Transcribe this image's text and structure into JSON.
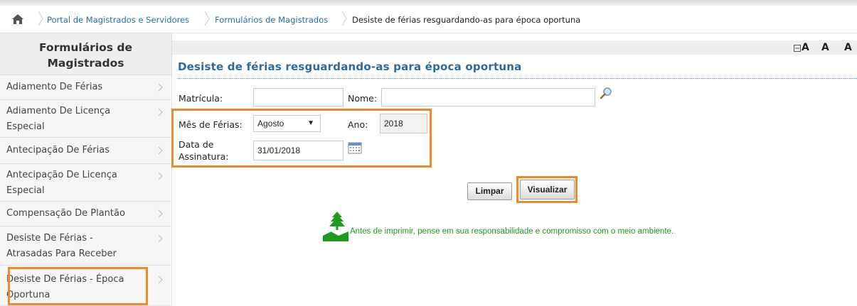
{
  "breadcrumb": {
    "items": [
      {
        "label": "Portal de Magistrados e Servidores"
      },
      {
        "label": "Formulários de Magistrados"
      },
      {
        "label": "Desiste de férias resguardando-as para época oportuna"
      }
    ]
  },
  "sidebar": {
    "title_line1": "Formulários de",
    "title_line2": "Magistrados",
    "items": [
      {
        "line1": "Adiamento De Férias",
        "line2": ""
      },
      {
        "line1": "Adiamento De Licença",
        "line2": "Especial"
      },
      {
        "line1": "Antecipação De Férias",
        "line2": ""
      },
      {
        "line1": "Antecipação De Licença",
        "line2": "Especial"
      },
      {
        "line1": "Compensação De Plantão",
        "line2": ""
      },
      {
        "line1": "Desiste De Férias -",
        "line2": "Atrasadas Para Receber"
      },
      {
        "line1": "Desiste De Férias - Época",
        "line2": "Oportuna"
      }
    ]
  },
  "toolbar": {
    "font_decrease": "A",
    "font_normal": "A",
    "font_increase": "A"
  },
  "page": {
    "title": "Desiste de férias resguardando-as para época oportuna"
  },
  "form": {
    "matricula_label": "Matrícula:",
    "matricula_value": "",
    "nome_label": "Nome:",
    "nome_value": "",
    "mes_label": "Mês de Férias:",
    "mes_value": "Agosto",
    "ano_label": "Ano:",
    "ano_value": "2018",
    "data_label_line1": "Data de",
    "data_label_line2": "Assinatura:",
    "data_value": "31/01/2018"
  },
  "buttons": {
    "limpar": "Limpar",
    "visualizar": "Visualizar"
  },
  "eco": {
    "text": "Antes de imprimir, pense em sua responsabilidade e compromisso com o meio ambiente."
  },
  "colors": {
    "accent": "#2a6aa0",
    "highlight": "#f08a24",
    "eco_green": "#1e9a1e"
  }
}
